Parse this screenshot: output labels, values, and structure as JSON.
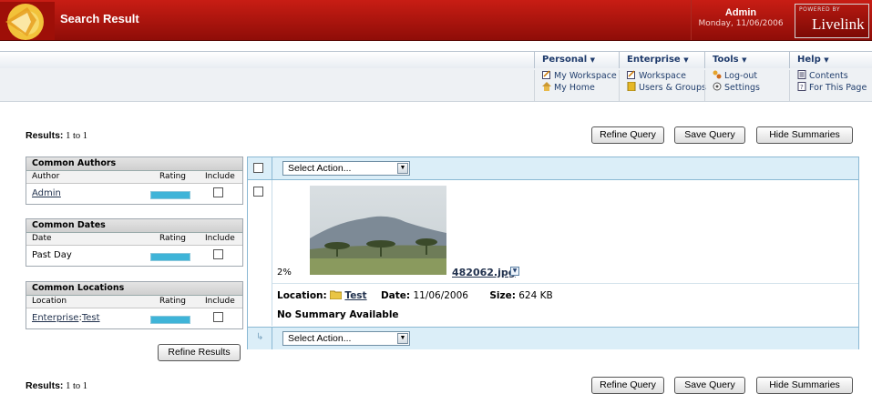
{
  "header": {
    "title": "Search Result",
    "user_name": "Admin",
    "date": "Monday, 11/06/2006",
    "powered_by": "POWERED BY",
    "brand": "Livelink"
  },
  "menu": {
    "personal": {
      "label": "Personal",
      "items": [
        {
          "label": "My Workspace",
          "icon": "workspace-icon"
        },
        {
          "label": "My Home",
          "icon": "home-icon"
        }
      ]
    },
    "enterprise": {
      "label": "Enterprise",
      "items": [
        {
          "label": "Workspace",
          "icon": "workspace-icon"
        },
        {
          "label": "Users & Groups",
          "icon": "users-icon"
        }
      ]
    },
    "tools": {
      "label": "Tools",
      "items": [
        {
          "label": "Log-out",
          "icon": "logout-icon"
        },
        {
          "label": "Settings",
          "icon": "settings-icon"
        }
      ]
    },
    "help": {
      "label": "Help",
      "items": [
        {
          "label": "Contents",
          "icon": "contents-icon"
        },
        {
          "label": "For This Page",
          "icon": "page-help-icon"
        }
      ]
    }
  },
  "results": {
    "label": "Results:",
    "range": "1 to 1",
    "refine_query": "Refine Query",
    "save_query": "Save Query",
    "hide_summaries": "Hide Summaries"
  },
  "facets": {
    "authors": {
      "title": "Common Authors",
      "col1": "Author",
      "col2": "Rating",
      "col3": "Include",
      "rows": [
        {
          "name": "Admin",
          "rating": 1.0
        }
      ]
    },
    "dates": {
      "title": "Common Dates",
      "col1": "Date",
      "col2": "Rating",
      "col3": "Include",
      "rows": [
        {
          "name": "Past Day",
          "rating": 1.0
        }
      ]
    },
    "locations": {
      "title": "Common Locations",
      "col1": "Location",
      "col2": "Rating",
      "col3": "Include",
      "rows": [
        {
          "name_part1": "Enterprise",
          "sep": ":",
          "name_part2": "Test",
          "rating": 1.0
        }
      ]
    },
    "refine_results": "Refine Results"
  },
  "result_list": {
    "select_action": "Select Action...",
    "item": {
      "score": "2%",
      "filename": "482062.jpg",
      "location_label": "Location:",
      "location": "Test",
      "date_label": "Date:",
      "date": "11/06/2006",
      "size_label": "Size:",
      "size": "624 KB",
      "summary": "No Summary Available"
    }
  },
  "colors": {
    "header_red": "#b4140c",
    "table_blue": "#dbeef8",
    "rating_bar": "#3fb4d8",
    "menu_text": "#1e3a6b"
  }
}
